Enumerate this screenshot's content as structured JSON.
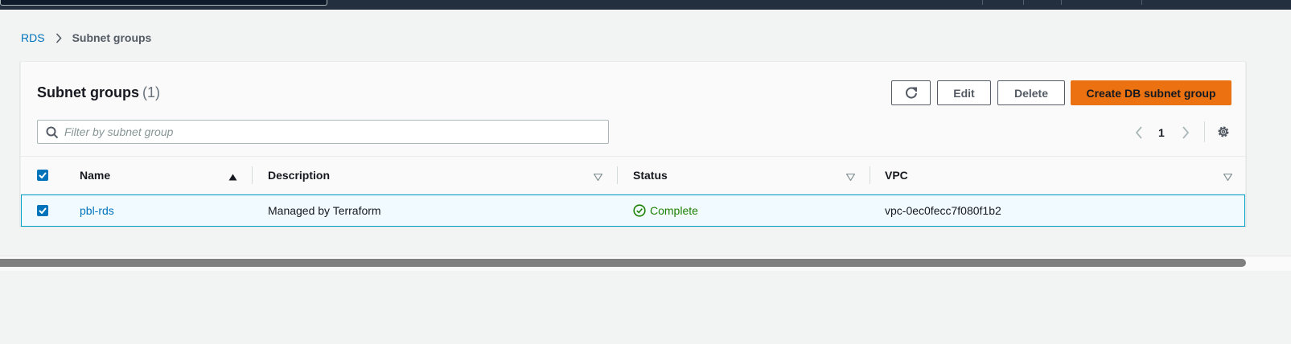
{
  "breadcrumb": {
    "root": "RDS",
    "current": "Subnet groups"
  },
  "panel": {
    "title": "Subnet groups",
    "count": "(1)",
    "buttons": {
      "edit": "Edit",
      "delete": "Delete",
      "create": "Create DB subnet group"
    },
    "filter": {
      "placeholder": "Filter by subnet group",
      "value": ""
    },
    "pagination": {
      "current_page": "1"
    }
  },
  "table": {
    "columns": [
      "Name",
      "Description",
      "Status",
      "VPC"
    ],
    "sorted_column": "Name",
    "sort_direction": "ascending",
    "rows": [
      {
        "selected": true,
        "name": "pbl-rds",
        "description": "Managed by Terraform",
        "status": "Complete",
        "vpc": "vpc-0ec0fecc7f080f1b2"
      }
    ]
  },
  "colors": {
    "link": "#0073bb",
    "primary_button": "#ec7211",
    "status_success": "#1d8102",
    "topbar": "#232f3e",
    "selected_row_bg": "#f1faff",
    "selected_row_border": "#00a1c9"
  }
}
